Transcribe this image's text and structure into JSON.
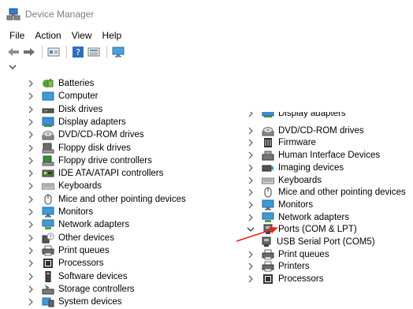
{
  "window": {
    "title": "Device Manager",
    "icon": "device-manager-icon"
  },
  "menu": [
    "File",
    "Action",
    "View",
    "Help"
  ],
  "toolbar": [
    "back-icon",
    "forward-icon",
    "properties-icon",
    "help-icon",
    "view-icon",
    "monitor-icon"
  ],
  "left_tree": [
    {
      "label": "Batteries",
      "icon": "battery-icon"
    },
    {
      "label": "Computer",
      "icon": "computer-icon"
    },
    {
      "label": "Disk drives",
      "icon": "disk-drive-icon"
    },
    {
      "label": "Display adapters",
      "icon": "display-adapter-icon"
    },
    {
      "label": "DVD/CD-ROM drives",
      "icon": "dvd-drive-icon"
    },
    {
      "label": "Floppy disk drives",
      "icon": "floppy-disk-icon"
    },
    {
      "label": "Floppy drive controllers",
      "icon": "floppy-controller-icon"
    },
    {
      "label": "IDE ATA/ATAPI controllers",
      "icon": "ide-controller-icon"
    },
    {
      "label": "Keyboards",
      "icon": "keyboard-icon"
    },
    {
      "label": "Mice and other pointing devices",
      "icon": "mouse-icon"
    },
    {
      "label": "Monitors",
      "icon": "monitor-icon"
    },
    {
      "label": "Network adapters",
      "icon": "network-adapter-icon"
    },
    {
      "label": "Other devices",
      "icon": "other-devices-icon"
    },
    {
      "label": "Print queues",
      "icon": "printer-icon"
    },
    {
      "label": "Processors",
      "icon": "processor-icon"
    },
    {
      "label": "Software devices",
      "icon": "software-device-icon"
    },
    {
      "label": "Storage controllers",
      "icon": "storage-controller-icon"
    },
    {
      "label": "System devices",
      "icon": "system-devices-icon"
    }
  ],
  "right_tree": [
    {
      "label": "Display adapters",
      "icon": "display-adapter-icon",
      "cut": true
    },
    {
      "label": "DVD/CD-ROM drives",
      "icon": "dvd-drive-icon"
    },
    {
      "label": "Firmware",
      "icon": "firmware-icon"
    },
    {
      "label": "Human Interface Devices",
      "icon": "hid-icon"
    },
    {
      "label": "Imaging devices",
      "icon": "camera-icon"
    },
    {
      "label": "Keyboards",
      "icon": "keyboard-icon"
    },
    {
      "label": "Mice and other pointing devices",
      "icon": "mouse-icon"
    },
    {
      "label": "Monitors",
      "icon": "monitor-icon"
    },
    {
      "label": "Network adapters",
      "icon": "network-adapter-icon"
    },
    {
      "label": "Ports (COM & LPT)",
      "icon": "port-icon",
      "expanded": true
    },
    {
      "label": "USB Serial Port (COM5)",
      "icon": "port-icon",
      "child": true
    },
    {
      "label": "Print queues",
      "icon": "printer-icon"
    },
    {
      "label": "Printers",
      "icon": "printer-icon"
    },
    {
      "label": "Processors",
      "icon": "processor-icon"
    }
  ],
  "annotation": {
    "arrow_color": "#e8221b"
  }
}
